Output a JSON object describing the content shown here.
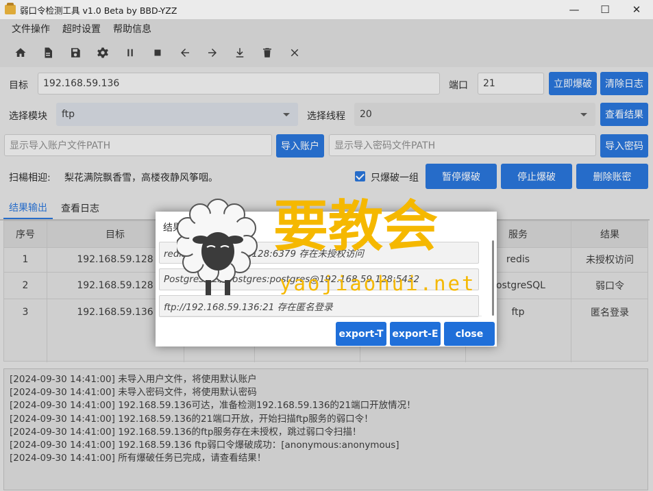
{
  "window": {
    "title": "弱口令检测工具 v1.0 Beta by BBD-YZZ",
    "controls": {
      "minimize": "—",
      "maximize": "☐",
      "close": "✕"
    }
  },
  "menu": [
    "文件操作",
    "超时设置",
    "帮助信息"
  ],
  "toolbar": [
    "home-icon",
    "file-icon",
    "save-icon",
    "gear-icon",
    "pause-icon",
    "stop-icon",
    "arrow-left-icon",
    "arrow-right-icon",
    "download-icon",
    "trash-icon",
    "close-icon"
  ],
  "target": {
    "label": "目标",
    "value": "192.168.59.136",
    "port_label": "端口",
    "port_value": "21",
    "scan_button": "立即爆破",
    "clear_button": "清除日志"
  },
  "module": {
    "label": "选择模块",
    "value": "ftp",
    "thread_label": "选择线程",
    "thread_value": "20",
    "view_button": "查看结果"
  },
  "import": {
    "account_placeholder": "显示导入账户文件PATH",
    "account_button": "导入账户",
    "password_placeholder": "显示导入密码文件PATH",
    "password_button": "导入密码"
  },
  "scan": {
    "greeting_label": "扫楊相迎:",
    "greeting_text": "梨花满院飘香雪，高楼夜静风筝咽。",
    "only_one_label": "只爆破一组",
    "only_one_checked": true,
    "pause_button": "暂停爆破",
    "stop_button": "停止爆破",
    "delete_button": "删除账密"
  },
  "tabs": [
    "结果输出",
    "查看日志"
  ],
  "table": {
    "headers": [
      "序号",
      "目标",
      "",
      "",
      "",
      "服务",
      "结果"
    ],
    "rows": [
      {
        "no": "1",
        "target": "192.168.59.128",
        "service": "redis",
        "result": "未授权访问"
      },
      {
        "no": "2",
        "target": "192.168.59.128",
        "service": "PostgreSQL",
        "result": "弱口令"
      },
      {
        "no": "3",
        "target": "192.168.59.136",
        "service": "ftp",
        "result": "匿名登录"
      }
    ]
  },
  "log": [
    "[2024-09-30 14:41:00] 未导入用户文件，将使用默认账户",
    "[2024-09-30 14:41:00] 未导入密码文件，将使用默认密码",
    "[2024-09-30 14:41:00] 192.168.59.136可达，准备检测192.168.59.136的21端口开放情况！",
    "[2024-09-30 14:41:00] 192.168.59.136的21端口开放，开始扫描ftp服务的弱口令！",
    "[2024-09-30 14:41:00] 192.168.59.136的ftp服务存在未授权，跳过弱口令扫描！",
    "[2024-09-30 14:41:00] 192.168.59.136 ftp弱口令爆破成功：[anonymous:anonymous]",
    "[2024-09-30 14:41:00] 所有爆破任务已完成，请查看结果！"
  ],
  "dialog": {
    "title": "结果(可复制结果)：",
    "results": [
      "redis://192.168.59.128:6379 存在未授权访问",
      "PostgreSQL://postgres:postgres@192.168.59.128:5432",
      "ftp://192.168.59.136:21 存在匿名登录"
    ],
    "buttons": [
      "export-T",
      "export-E",
      "close"
    ]
  },
  "watermark": {
    "cn": "要教会",
    "en": "yaojiaohui.net"
  },
  "colors": {
    "accent": "#1f6fd9",
    "watermark": "#f5b800"
  }
}
